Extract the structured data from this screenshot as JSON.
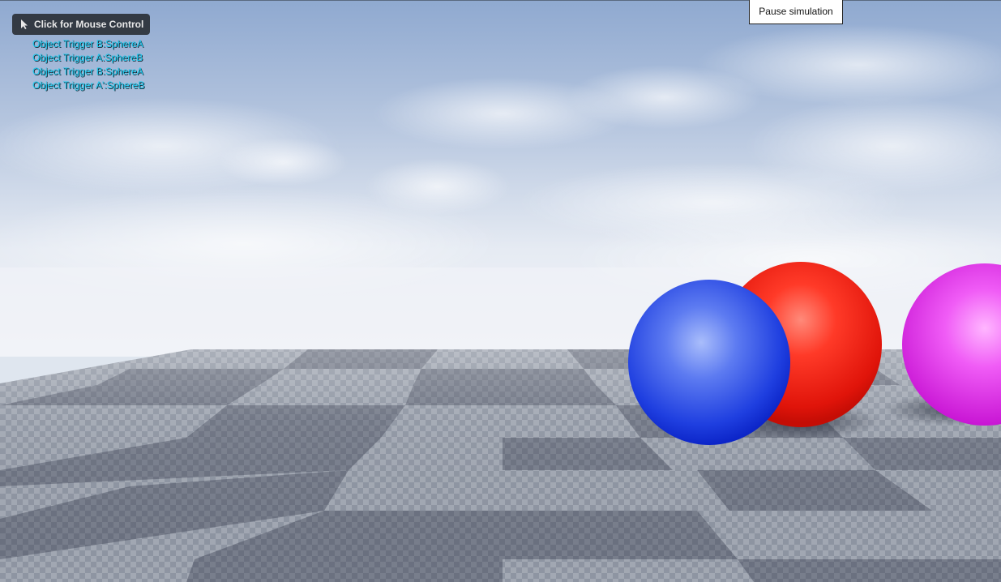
{
  "overlay": {
    "mouse_control_label": "Click for Mouse Control",
    "pause_label": "Pause simulation"
  },
  "log": [
    "Object Trigger B:SphereA",
    "Object Trigger A:SphereB",
    "Object Trigger B:SphereA",
    "Object Trigger A':SphereB"
  ],
  "colors": {
    "log_text": "#19c9ee",
    "sphere_blue": "#3a5cf0",
    "sphere_red": "#f21d12",
    "sphere_magenta": "#e63ef0",
    "floor": "#8f96a3"
  },
  "icons": {
    "cursor": "mouse-cursor-icon"
  }
}
